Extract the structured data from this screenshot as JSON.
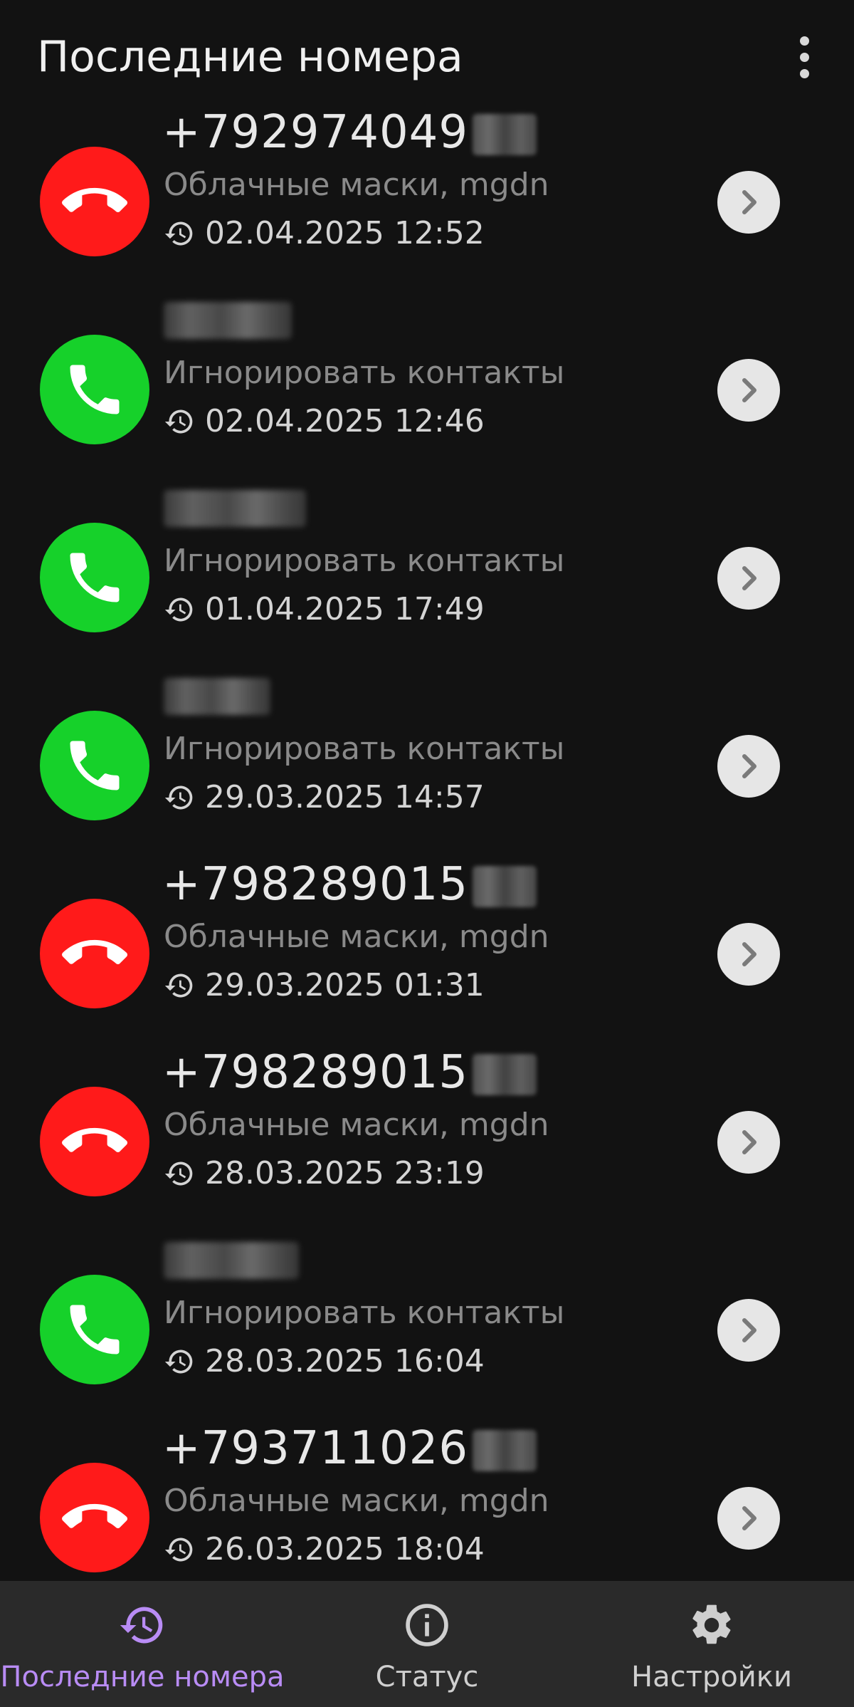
{
  "header": {
    "title": "Последние номера"
  },
  "colors": {
    "declined": "#ff1a1a",
    "allowed": "#16d12a",
    "accent": "#b98cf5",
    "background": "#121212",
    "nav_background": "#2a2a2a"
  },
  "calls": [
    {
      "number": "+792974049",
      "masked_name": false,
      "status": "declined",
      "status_icon": "phone-hangup-icon",
      "rule": "Облачные маски, mgdn",
      "datetime": "02.04.2025 12:52"
    },
    {
      "number": "",
      "masked_name": true,
      "status": "allowed",
      "status_icon": "phone-icon",
      "rule": "Игнорировать контакты",
      "datetime": "02.04.2025 12:46"
    },
    {
      "number": "",
      "masked_name": true,
      "status": "allowed",
      "status_icon": "phone-icon",
      "rule": "Игнорировать контакты",
      "datetime": "01.04.2025 17:49"
    },
    {
      "number": "",
      "masked_name": true,
      "status": "allowed",
      "status_icon": "phone-icon",
      "rule": "Игнорировать контакты",
      "datetime": "29.03.2025 14:57"
    },
    {
      "number": "+798289015",
      "masked_name": false,
      "status": "declined",
      "status_icon": "phone-hangup-icon",
      "rule": "Облачные маски, mgdn",
      "datetime": "29.03.2025 01:31"
    },
    {
      "number": "+798289015",
      "masked_name": false,
      "status": "declined",
      "status_icon": "phone-hangup-icon",
      "rule": "Облачные маски, mgdn",
      "datetime": "28.03.2025 23:19"
    },
    {
      "number": "",
      "masked_name": true,
      "status": "allowed",
      "status_icon": "phone-icon",
      "rule": "Игнорировать контакты",
      "datetime": "28.03.2025 16:04"
    },
    {
      "number": "+793711026",
      "masked_name": false,
      "status": "declined",
      "status_icon": "phone-hangup-icon",
      "rule": "Облачные маски, mgdn",
      "datetime": "26.03.2025 18:04"
    }
  ],
  "nav": [
    {
      "label": "Последние номера",
      "icon": "history-icon",
      "active": true
    },
    {
      "label": "Статус",
      "icon": "info-icon",
      "active": false
    },
    {
      "label": "Настройки",
      "icon": "gear-icon",
      "active": false
    }
  ]
}
